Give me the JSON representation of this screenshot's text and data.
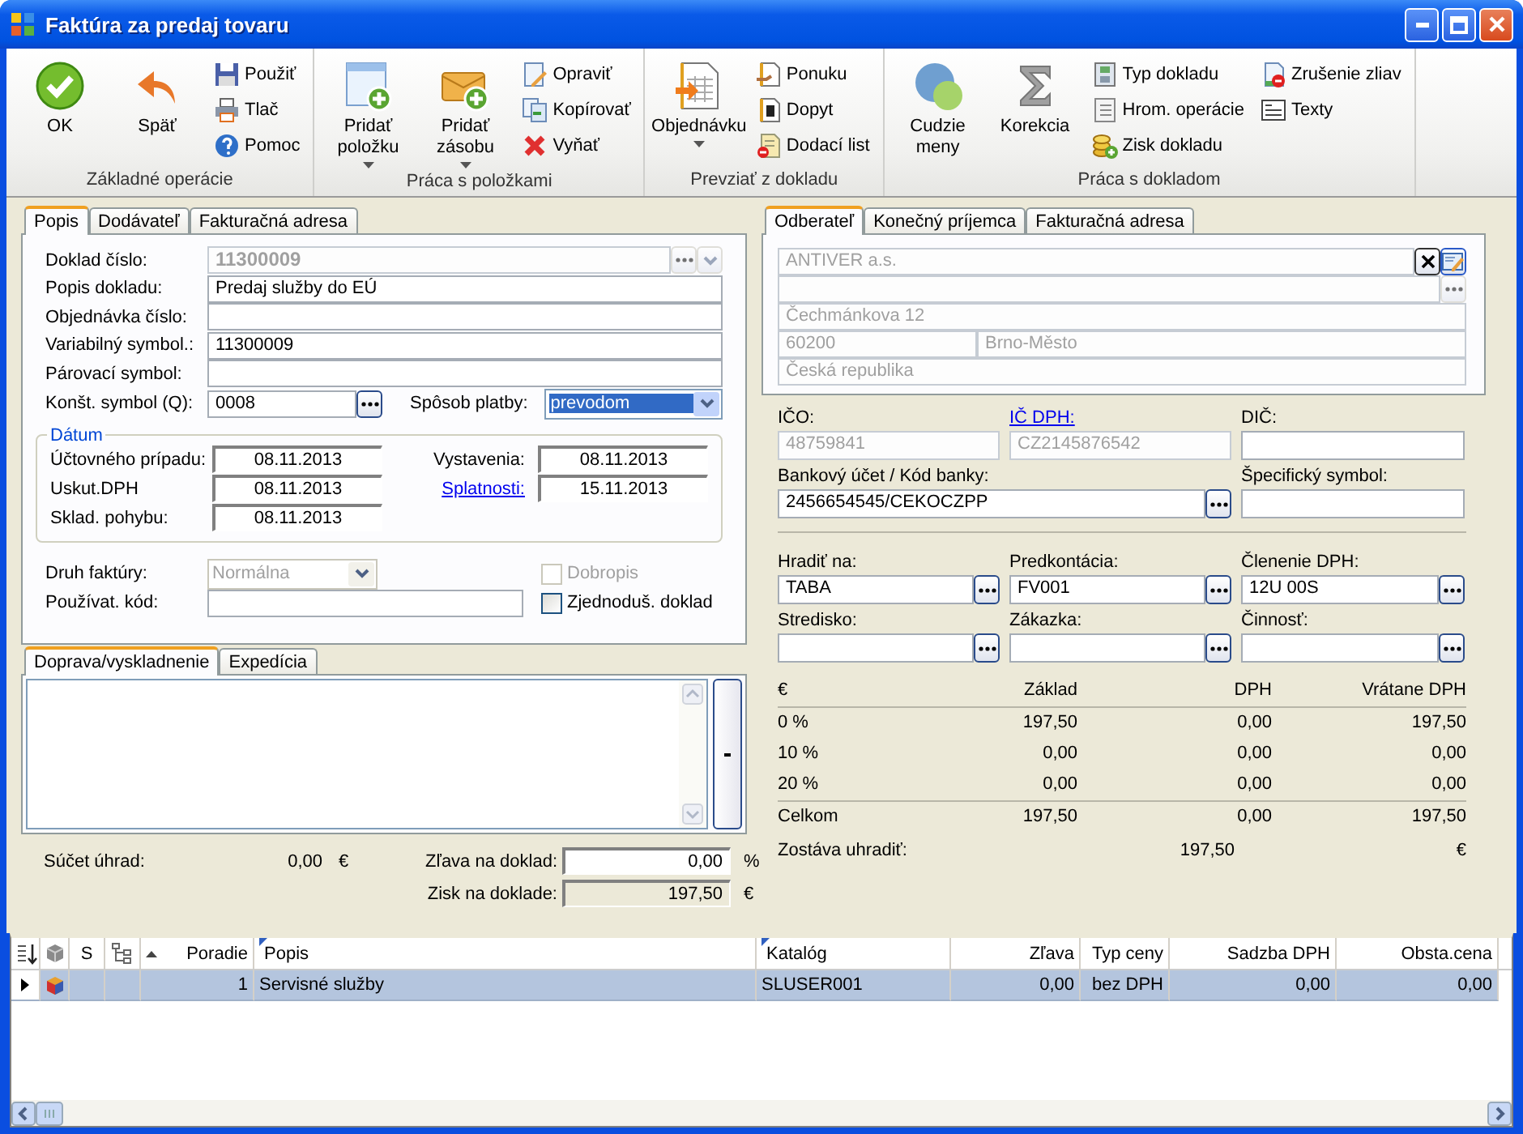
{
  "window": {
    "title": "Faktúra za predaj tovaru"
  },
  "ribbon": {
    "groups": [
      {
        "label": "Základné operácie",
        "items": [
          {
            "kind": "large",
            "label": "OK",
            "dropdown": false
          },
          {
            "kind": "large",
            "label": "Späť",
            "dropdown": false
          },
          {
            "kind": "small",
            "label": "Použiť",
            "dropdown": false
          },
          {
            "kind": "small",
            "label": "Tlač",
            "dropdown": false
          },
          {
            "kind": "small",
            "label": "Pomoc",
            "dropdown": false
          }
        ]
      },
      {
        "label": "Práca s položkami",
        "items": [
          {
            "kind": "large",
            "label": "Pridať položku",
            "dropdown": true
          },
          {
            "kind": "large",
            "label": "Pridať zásobu",
            "dropdown": true
          },
          {
            "kind": "small",
            "label": "Opraviť",
            "dropdown": false
          },
          {
            "kind": "small",
            "label": "Kopírovať",
            "dropdown": false
          },
          {
            "kind": "small",
            "label": "Vyňať",
            "dropdown": false
          }
        ]
      },
      {
        "label": "Prevziať z dokladu",
        "items": [
          {
            "kind": "large",
            "label": "Objednávku",
            "dropdown": true
          },
          {
            "kind": "small",
            "label": "Ponuku",
            "dropdown": false
          },
          {
            "kind": "small",
            "label": "Dopyt",
            "dropdown": false
          },
          {
            "kind": "small",
            "label": "Dodací list",
            "dropdown": false
          }
        ]
      },
      {
        "label": "Práca s dokladom",
        "items": [
          {
            "kind": "large",
            "label": "Cudzie meny",
            "dropdown": false
          },
          {
            "kind": "large",
            "label": "Korekcia",
            "dropdown": false
          },
          {
            "kind": "small",
            "label": "Typ dokladu",
            "dropdown": false
          },
          {
            "kind": "small",
            "label": "Hrom. operácie",
            "dropdown": false
          },
          {
            "kind": "small",
            "label": "Zisk dokladu",
            "dropdown": false
          },
          {
            "kind": "small",
            "label": "Zrušenie zliav",
            "dropdown": false
          },
          {
            "kind": "small",
            "label": "Texty",
            "dropdown": false
          }
        ]
      }
    ]
  },
  "left_tabs": [
    {
      "label": "Popis",
      "selected": true
    },
    {
      "label": "Dodávateľ",
      "selected": false
    },
    {
      "label": "Fakturačná adresa",
      "selected": false
    }
  ],
  "document": {
    "fields": [
      {
        "label": "Doklad číslo:",
        "value": "11300009",
        "readonly": true
      },
      {
        "label": "Popis dokladu:",
        "value": "Predaj služby do EÚ",
        "readonly": false
      },
      {
        "label": "Objednávka číslo:",
        "readonly": false
      },
      {
        "label": "Variabilný symbol.:",
        "value": "11300009",
        "readonly": false
      },
      {
        "label": "Párovací symbol:",
        "readonly": false
      }
    ],
    "constant_symbol": {
      "label": "Konšt. symbol (Q):",
      "value": "0008"
    },
    "payment": {
      "label": "Spôsob platby:",
      "value": "prevodom",
      "focused": true
    },
    "dates": {
      "title": "Dátum",
      "left": [
        {
          "label": "Účtovného prípadu:",
          "value": "08.11.2013"
        },
        {
          "label": "Uskut.DPH",
          "value": "08.11.2013"
        },
        {
          "label": "Sklad. pohybu:",
          "value": "08.11.2013"
        }
      ],
      "right": [
        {
          "label": "Vystavenia:",
          "value": "08.11.2013",
          "kind": "plain"
        },
        {
          "label": "Splatnosti:",
          "value": "15.11.2013",
          "kind": "link"
        }
      ]
    },
    "invoice_type": {
      "label": "Druh faktúry:",
      "value": "Normálna",
      "disabled": true
    },
    "credit_note": {
      "label": "Dobropis",
      "checked": false,
      "disabled": true
    },
    "user_code": {
      "label": "Používat. kód:"
    },
    "simplified": {
      "label": "Zjednoduš. doklad",
      "checked": false,
      "disabled": false
    }
  },
  "right_tabs": [
    {
      "label": "Odberateľ",
      "selected": true
    },
    {
      "label": "Konečný príjemca",
      "selected": false
    },
    {
      "label": "Fakturačná adresa",
      "selected": false
    }
  ],
  "customer": {
    "name": "ANTIVER a.s.",
    "street": "Čechmánkova 12",
    "zip": "60200",
    "city": "Brno-Město",
    "country": "Česká republika"
  },
  "customer_fields": [
    {
      "label": "IČO:",
      "value": "48759841",
      "readonly": true,
      "link": false,
      "lookup": false,
      "kind": "normal"
    },
    {
      "label": "IČ DPH:",
      "value": "CZ2145876542",
      "readonly": true,
      "link": true,
      "lookup": false,
      "kind": "normal"
    },
    {
      "label": "DIČ:",
      "readonly": false,
      "link": false,
      "lookup": false,
      "kind": "normal"
    },
    {
      "label": "Bankový účet / Kód banky:",
      "value": "2456654545/CEKOCZPP",
      "readonly": false,
      "link": false,
      "lookup": true,
      "kind": "wide"
    },
    {
      "label": "Špecifický symbol:",
      "readonly": false,
      "link": false,
      "lookup": false,
      "kind": "normal"
    }
  ],
  "accounting_fields": [
    {
      "label": "Hradiť na:",
      "value": "TABA"
    },
    {
      "label": "Predkontácia:",
      "value": "FV001"
    },
    {
      "label": "Členenie DPH:",
      "value": "12U 00S"
    },
    {
      "label": "Stredisko:"
    },
    {
      "label": "Zákazka:"
    },
    {
      "label": "Činnosť:"
    }
  ],
  "vat": {
    "columns": [
      "€",
      "Základ",
      "DPH",
      "Vrátane DPH"
    ],
    "rows": [
      [
        "0 %",
        "197,50",
        "0,00",
        "197,50"
      ],
      [
        "10 %",
        "0,00",
        "0,00",
        "0,00"
      ],
      [
        "20 %",
        "0,00",
        "0,00",
        "0,00"
      ]
    ],
    "total": [
      "Celkom",
      "197,50",
      "0,00",
      "197,50"
    ],
    "remaining": {
      "label": "Zostáva uhradiť:",
      "value": "197,50",
      "unit": "€"
    }
  },
  "bottom_tabs": [
    {
      "label": "Doprava/vyskladnenie",
      "selected": true
    },
    {
      "label": "Expedícia",
      "selected": false
    }
  ],
  "totals": {
    "payments": {
      "label": "Súčet úhrad:",
      "value": "0,00",
      "unit": "€"
    },
    "discount": {
      "label": "Zľava na doklad:",
      "value": "0,00",
      "unit": "%"
    },
    "profit": {
      "label": "Zisk na doklade:",
      "value": "197,50",
      "unit": "€"
    }
  },
  "items_table": {
    "columns": [
      {
        "label": "S",
        "sorted": false,
        "flagged": false
      },
      {
        "label": "Poradie",
        "sorted": true,
        "flagged": false
      },
      {
        "label": "Popis",
        "sorted": false,
        "flagged": true
      },
      {
        "label": "Katalóg",
        "sorted": false,
        "flagged": true
      },
      {
        "label": "Zľava",
        "sorted": false,
        "flagged": false
      },
      {
        "label": "Typ ceny",
        "sorted": false,
        "flagged": false
      },
      {
        "label": "Sadzba DPH",
        "sorted": false,
        "flagged": false
      },
      {
        "label": "Obsta.cena",
        "sorted": false,
        "flagged": false
      }
    ],
    "rows": [
      {
        "selected": true,
        "cells": [
          null,
          "1",
          "Servisné služby",
          "SLUSER001",
          "0,00",
          "bez DPH",
          "0,00",
          "0,00"
        ]
      }
    ]
  }
}
